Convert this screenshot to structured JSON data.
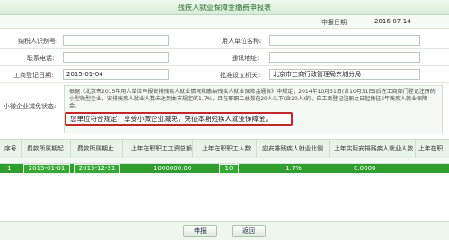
{
  "window": {
    "title": "残疾人就业保障金缴费申报表"
  },
  "header": {
    "date_label": "申报日期:",
    "date_value": "2016-07-14"
  },
  "form": {
    "taxpayer_id_label": "纳税人识别号:",
    "employer_name_label": "用人单位名称:",
    "phone_label": "联系电话:",
    "address_label": "通讯地址:",
    "reg_date_label": "工商登记日期:",
    "reg_date_value": "2015-01-04",
    "approver_label": "批准设立机关:",
    "approver_value": "北京市工商行政管理局东城分局"
  },
  "notice": {
    "side_label": "小微企业减免状态:",
    "text": "根据《北京市2015年用人单位申报安排残疾人就业情况和缴纳残疾人就业保障金通告》中规定，2014年10月31日(含10月31日)后在工商部门登记注册的小型微型企业，安排残疾人就业人数未达到本市规定的1.7%，且在职职工总数在20人以下(含20人)的，自工商登记注册之日起免征3年残疾人就业保障金。",
    "callout": "您单位符合规定，享受小微企业减免，免征本期残疾人就业保障金。"
  },
  "grid": {
    "columns": [
      "序号",
      "费款所属期起",
      "费款所属期止",
      "上年在职职工工资总额",
      "上年在职职工人数",
      "应安排残疾人就业比例",
      "上年实际安排残疾人就业人数",
      "上年在职"
    ],
    "rows": [
      {
        "no": "1",
        "from": "2015-01-01",
        "to": "2015-12-31",
        "salary": "1000000.00",
        "staff": "10",
        "ratio": "1.7%",
        "actual": "0.0000"
      }
    ]
  },
  "footer": {
    "submit_label": "申报",
    "back_label": "返回"
  }
}
